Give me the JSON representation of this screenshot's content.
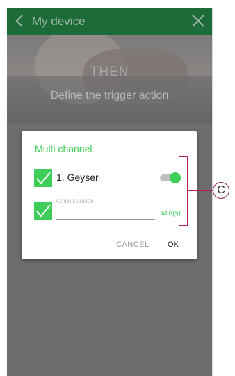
{
  "header": {
    "title": "My device"
  },
  "hero": {
    "heading": "THEN",
    "subtitle": "Define the trigger action"
  },
  "dialog": {
    "title": "Multi channel",
    "channel": {
      "label": "1. Geyser",
      "checked": true,
      "toggle_on": true
    },
    "duration": {
      "placeholder": "Action Duration",
      "value": "",
      "unit": "Min(s)",
      "checked": true
    },
    "cancel_label": "CANCEL",
    "ok_label": "OK"
  },
  "callout": {
    "letter": "C"
  },
  "colors": {
    "accent": "#3dcd58",
    "header_bg": "#1e6b3a",
    "callout": "#b21e5e"
  },
  "icons": [
    "back-arrow-icon",
    "close-icon",
    "checkmark-icon"
  ]
}
